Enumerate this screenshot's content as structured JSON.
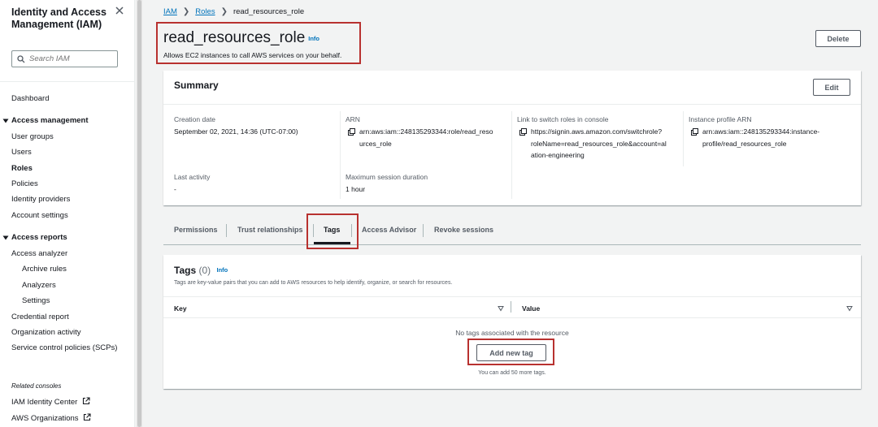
{
  "sidebar": {
    "title": "Identity and Access Management (IAM)",
    "search_placeholder": "Search IAM",
    "dashboard": "Dashboard",
    "access_management": {
      "heading": "Access management",
      "items": [
        "User groups",
        "Users",
        "Roles",
        "Policies",
        "Identity providers",
        "Account settings"
      ],
      "active": "Roles"
    },
    "access_reports": {
      "heading": "Access reports",
      "items": [
        "Access analyzer",
        "Archive rules",
        "Analyzers",
        "Settings",
        "Credential report",
        "Organization activity",
        "Service control policies (SCPs)"
      ]
    },
    "related_label": "Related consoles",
    "related": [
      "IAM Identity Center",
      "AWS Organizations"
    ]
  },
  "breadcrumb": {
    "items": [
      "IAM",
      "Roles",
      "read_resources_role"
    ]
  },
  "header": {
    "title": "read_resources_role",
    "info": "Info",
    "description": "Allows EC2 instances to call AWS services on your behalf.",
    "delete_label": "Delete"
  },
  "summary": {
    "title": "Summary",
    "edit_label": "Edit",
    "creation_date": {
      "label": "Creation date",
      "value": "September 02, 2021, 14:36 (UTC-07:00)"
    },
    "arn": {
      "label": "ARN",
      "line1": "arn:aws:iam::248135293344:role/read_reso",
      "line2": "urces_role"
    },
    "switch_link": {
      "label": "Link to switch roles in console",
      "line1": "https://signin.aws.amazon.com/switchrole?",
      "line2": "roleName=read_resources_role&account=al",
      "line3": "ation-engineering"
    },
    "instance_profile": {
      "label": "Instance profile ARN",
      "line1": "arn:aws:iam::248135293344:instance-",
      "line2": "profile/read_resources_role"
    },
    "last_activity": {
      "label": "Last activity",
      "value": "-"
    },
    "max_session": {
      "label": "Maximum session duration",
      "value": "1 hour"
    }
  },
  "tabs": {
    "items": [
      "Permissions",
      "Trust relationships",
      "Tags",
      "Access Advisor",
      "Revoke sessions"
    ],
    "active": "Tags"
  },
  "tags": {
    "title": "Tags",
    "count": "(0)",
    "info": "Info",
    "description": "Tags are key-value pairs that you can add to AWS resources to help identify, organize, or search for resources.",
    "col_key": "Key",
    "col_value": "Value",
    "empty": "No tags associated with the resource",
    "add_label": "Add new tag",
    "limit": "You can add 50 more tags."
  },
  "colors": {
    "link": "#0073bb",
    "highlight": "#b8312f",
    "text": "#16191f",
    "muted": "#545b64",
    "background": "#f2f3f3"
  }
}
